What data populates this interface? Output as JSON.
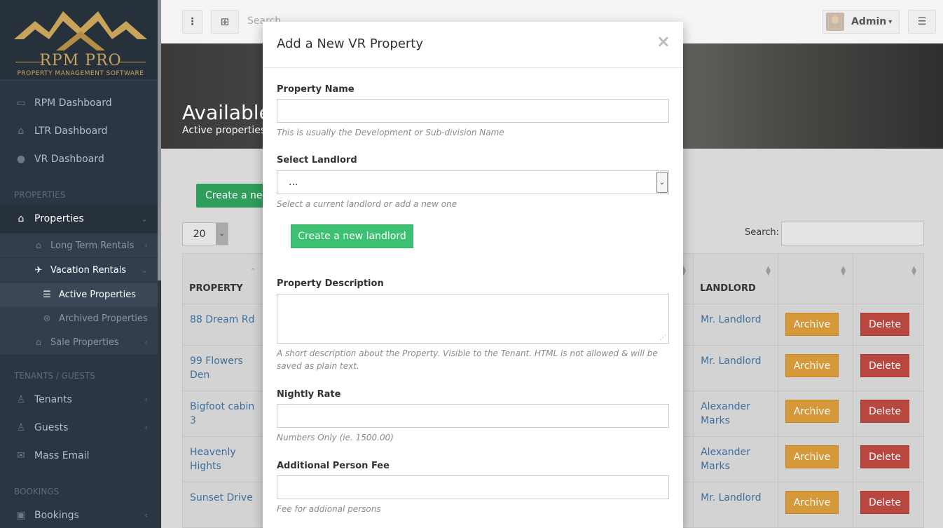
{
  "brand": {
    "name": "RPM PRO",
    "tagline": "PROPERTY MANAGEMENT SOFTWARE"
  },
  "sidebar": {
    "items": [
      {
        "label": "RPM Dashboard",
        "icon": "monitor-icon"
      },
      {
        "label": "LTR Dashboard",
        "icon": "home-icon"
      },
      {
        "label": "VR Dashboard",
        "icon": "bulb-icon"
      }
    ],
    "section_properties": "PROPERTIES",
    "properties_label": "Properties",
    "long_term": "Long Term Rentals",
    "vacation": "Vacation Rentals",
    "active_props": "Active Properties",
    "archived_props": "Archived Properties",
    "sale_props": "Sale Properties",
    "section_tenants": "TENANTS / GUESTS",
    "tenants": "Tenants",
    "guests": "Guests",
    "mass_email": "Mass Email",
    "section_bookings": "BOOKINGS",
    "bookings": "Bookings"
  },
  "topbar": {
    "search_placeholder": "Search",
    "user_name": "Admin"
  },
  "hero": {
    "title": "Available",
    "subtitle": "Active properties"
  },
  "main": {
    "create_button": "Create a new",
    "page_size": "20",
    "search_label": "Search:",
    "columns": [
      "PROPERTY",
      "LANDLORD"
    ],
    "rows": [
      {
        "property": "88 Dream Rd",
        "landlord": "Mr. Landlord"
      },
      {
        "property": "99 Flowers Den",
        "landlord": "Mr. Landlord"
      },
      {
        "property": "Bigfoot cabin 3",
        "landlord": "Alexander Marks"
      },
      {
        "property": "Heavenly Hights",
        "landlord": "Alexander Marks"
      },
      {
        "property": "Sunset Drive",
        "landlord": "Mr. Landlord"
      }
    ],
    "archive_label": "Archive",
    "delete_label": "Delete"
  },
  "modal": {
    "title": "Add a New VR Property",
    "close": "×",
    "property_name_label": "Property Name",
    "property_name_help": "This is usually the Development or Sub-division Name",
    "landlord_label": "Select Landlord",
    "landlord_value": "...",
    "landlord_help": "Select a current landlord or add a new one",
    "create_landlord": "Create a new landlord",
    "description_label": "Property Description",
    "description_help": "A short description about the Property. Visible to the Tenant. HTML is not allowed & will be saved as plain text.",
    "nightly_label": "Nightly Rate",
    "nightly_help": "Numbers Only (ie. 1500.00)",
    "addl_label": "Additional Person Fee",
    "addl_help": "Fee for addional persons"
  }
}
